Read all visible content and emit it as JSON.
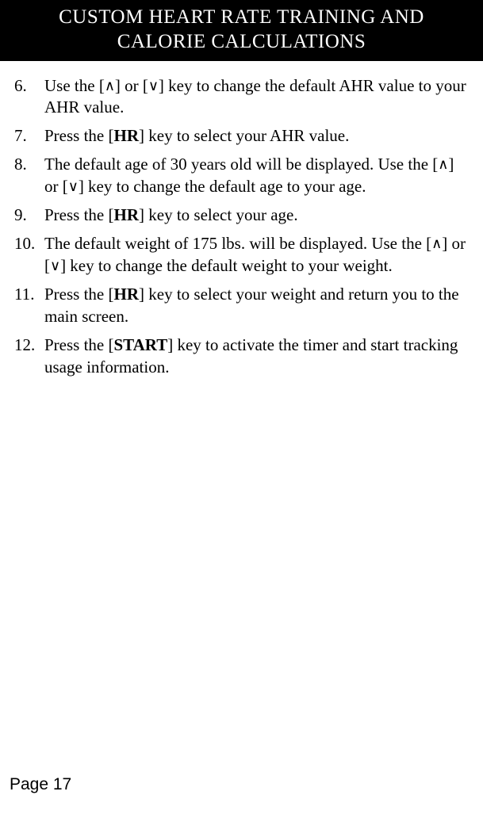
{
  "header": {
    "title_line1": "CUSTOM HEART RATE TRAINING AND",
    "title_line2": "CALORIE CALCULATIONS"
  },
  "symbols": {
    "up": "∧",
    "down": "∨"
  },
  "steps": [
    {
      "num": "6.",
      "segments": [
        {
          "t": "Use the ["
        },
        {
          "t": "∧",
          "cls": "arrow"
        },
        {
          "t": "] or ["
        },
        {
          "t": "∨",
          "cls": "arrow"
        },
        {
          "t": "] key to change the default AHR value to your AHR value."
        }
      ]
    },
    {
      "num": "7.",
      "segments": [
        {
          "t": "Press the ["
        },
        {
          "t": "HR",
          "cls": "b"
        },
        {
          "t": "] key to select your AHR value."
        }
      ]
    },
    {
      "num": "8.",
      "segments": [
        {
          "t": "The default age of 30 years old will be displayed. Use the ["
        },
        {
          "t": "∧",
          "cls": "arrow"
        },
        {
          "t": "] or ["
        },
        {
          "t": "∨",
          "cls": "arrow"
        },
        {
          "t": "] key to change the default age to your age."
        }
      ]
    },
    {
      "num": "9.",
      "segments": [
        {
          "t": "Press the ["
        },
        {
          "t": "HR",
          "cls": "b"
        },
        {
          "t": "] key to select your age."
        }
      ]
    },
    {
      "num": "10.",
      "segments": [
        {
          "t": "The default weight of 175 lbs. will be displayed. Use the ["
        },
        {
          "t": "∧",
          "cls": "arrow"
        },
        {
          "t": "] or ["
        },
        {
          "t": "∨",
          "cls": "arrow"
        },
        {
          "t": "]  key to change the default weight to your weight."
        }
      ]
    },
    {
      "num": "11.",
      "segments": [
        {
          "t": "Press the ["
        },
        {
          "t": "HR",
          "cls": "b"
        },
        {
          "t": "] key to select your weight and return you to the main screen."
        }
      ]
    },
    {
      "num": "12.",
      "segments": [
        {
          "t": "Press the ["
        },
        {
          "t": "START",
          "cls": "b"
        },
        {
          "t": "] key to activate the timer and start tracking usage information."
        }
      ]
    }
  ],
  "footer": {
    "page_label": "Page 17"
  }
}
